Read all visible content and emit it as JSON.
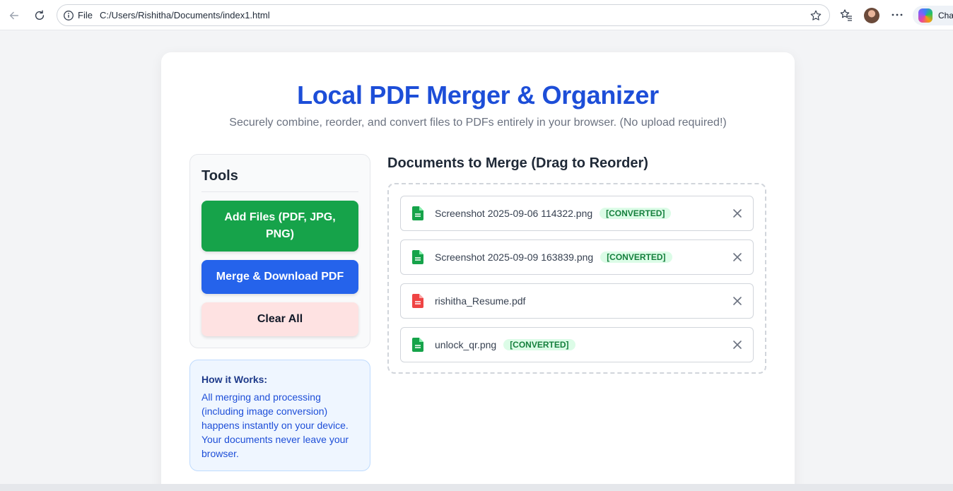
{
  "browser": {
    "omnibox_scheme": "File",
    "omnibox_url": "C:/Users/Rishitha/Documents/index1.html",
    "copilot_label": "Cha"
  },
  "page": {
    "title": "Local PDF Merger & Organizer",
    "subtitle": "Securely combine, reorder, and convert files to PDFs entirely in your browser. (No upload required!)"
  },
  "tools": {
    "heading": "Tools",
    "add_label": "Add Files (PDF, JPG, PNG)",
    "merge_label": "Merge & Download PDF",
    "clear_label": "Clear All"
  },
  "howto": {
    "heading": "How it Works:",
    "body": "All merging and processing (including image conversion) happens instantly on your device. Your documents never leave your browser."
  },
  "docs": {
    "heading": "Documents to Merge (Drag to Reorder)",
    "files": [
      {
        "name": "Screenshot 2025-09-06 114322.png",
        "badge": "[CONVERTED]",
        "icon": "green-document-icon",
        "color": "#16a34a"
      },
      {
        "name": "Screenshot 2025-09-09 163839.png",
        "badge": "[CONVERTED]",
        "icon": "green-document-icon",
        "color": "#16a34a"
      },
      {
        "name": "rishitha_Resume.pdf",
        "badge": "",
        "icon": "red-pdf-icon",
        "color": "#ef4444"
      },
      {
        "name": "unlock_qr.png",
        "badge": "[CONVERTED]",
        "icon": "green-document-icon",
        "color": "#16a34a"
      }
    ]
  },
  "colors": {
    "title_blue": "#1d4ed8",
    "add_green": "#16a34a",
    "merge_blue": "#2563eb",
    "clear_pink": "#fee2e2"
  }
}
